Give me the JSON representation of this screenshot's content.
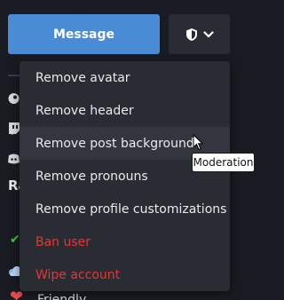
{
  "header": {
    "message_label": "Message",
    "moderation_icon": "shield-icon",
    "dropdown_icon": "chevron-down-icon"
  },
  "moderation_menu": {
    "items": [
      {
        "label": "Remove avatar",
        "danger": false
      },
      {
        "label": "Remove header",
        "danger": false
      },
      {
        "label": "Remove post background",
        "danger": false
      },
      {
        "label": "Remove pronouns",
        "danger": false
      },
      {
        "label": "Remove profile customizations",
        "danger": false
      },
      {
        "label": "Ban user",
        "danger": true
      },
      {
        "label": "Wipe account",
        "danger": true
      }
    ],
    "hovered_index": 2
  },
  "tooltip": {
    "text": "Moderation"
  },
  "background": {
    "partial_heading": "Ra",
    "partial_label": "Friendly"
  },
  "colors": {
    "page_bg": "#191b22",
    "button_primary": "#4a8bd6",
    "button_secondary": "#2a2c34",
    "menu_bg": "#2a2c34",
    "menu_hover": "#34363f",
    "danger": "#e8362f"
  }
}
